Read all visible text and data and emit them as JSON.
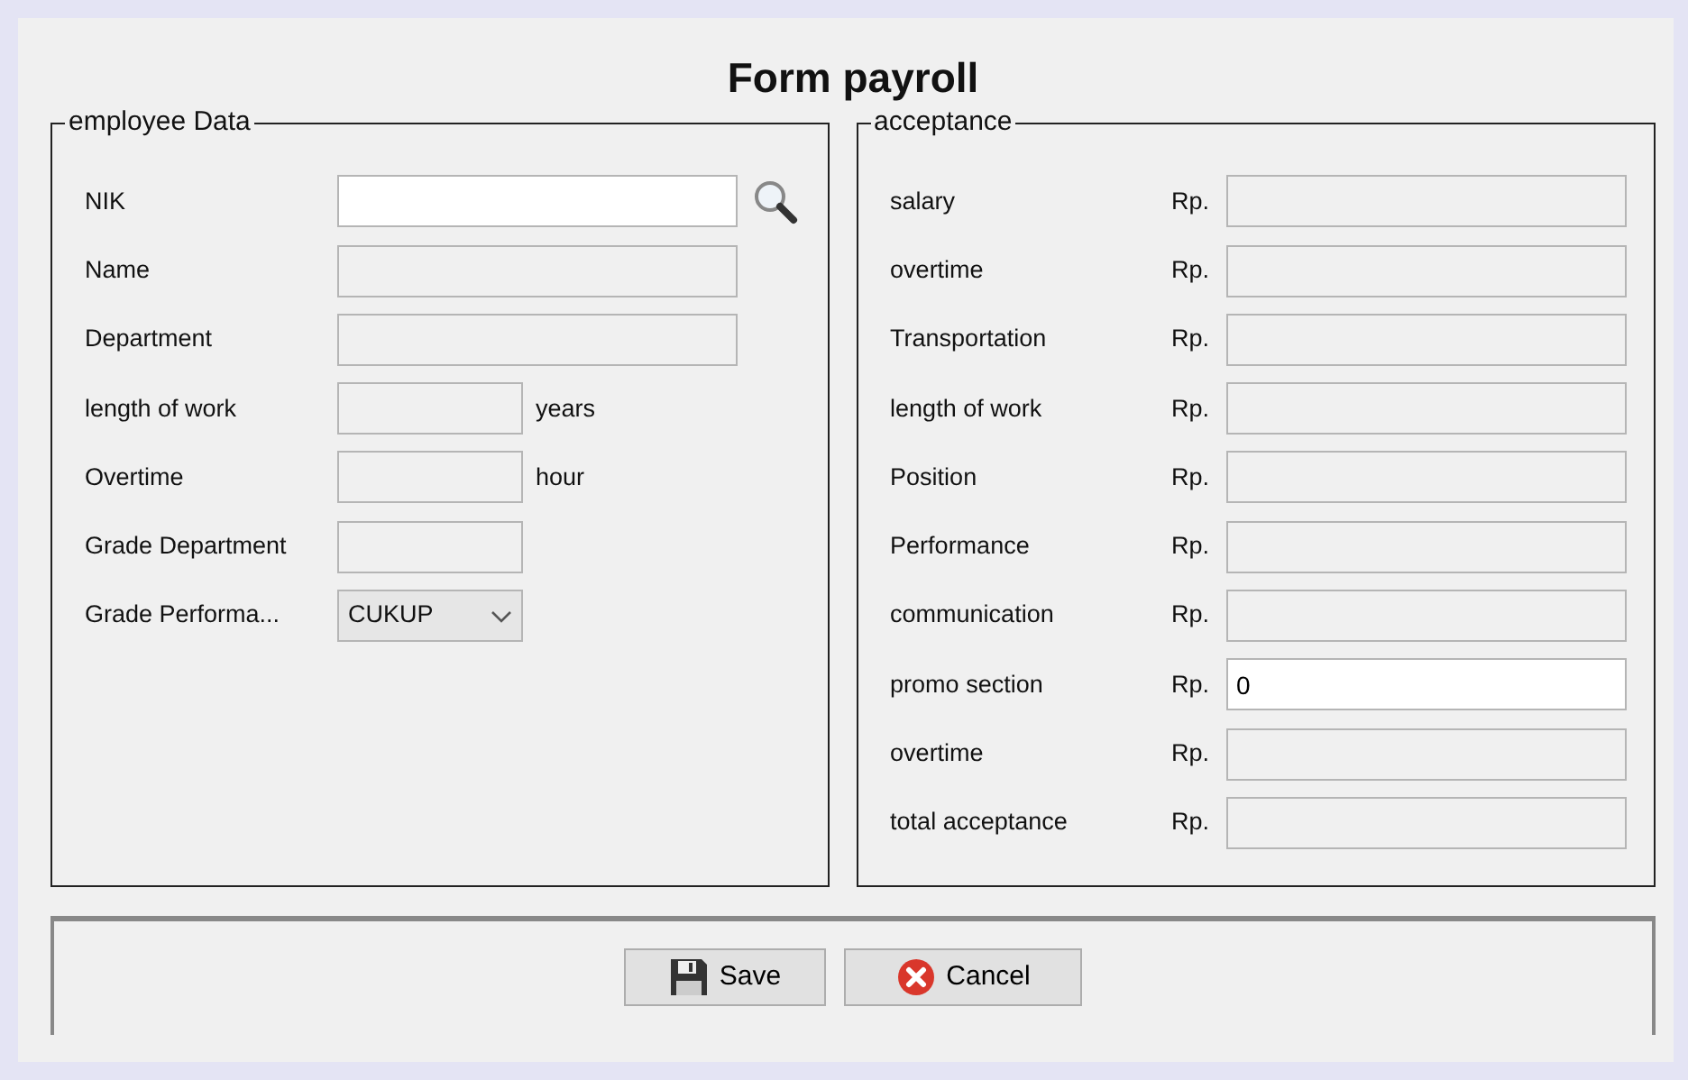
{
  "window": {
    "title": "Form payroll"
  },
  "employee_data": {
    "legend": "employee Data",
    "rows": [
      {
        "label": "NIK",
        "kind": "wide",
        "editable": true,
        "value": "",
        "search": true
      },
      {
        "label": "Name",
        "kind": "wide",
        "editable": false,
        "value": ""
      },
      {
        "label": "Department",
        "kind": "wide",
        "editable": false,
        "value": ""
      },
      {
        "label": "length of work",
        "kind": "short",
        "editable": false,
        "value": "",
        "unit": "years"
      },
      {
        "label": "Overtime",
        "kind": "short",
        "editable": false,
        "value": "",
        "unit": "hour"
      },
      {
        "label": "Grade Department",
        "kind": "short",
        "editable": false,
        "value": ""
      },
      {
        "label": "Grade Performa...",
        "kind": "select",
        "editable": false,
        "value": "CUKUP"
      }
    ]
  },
  "acceptance": {
    "legend": "acceptance",
    "rows": [
      {
        "label": "salary",
        "currency": "Rp.",
        "editable": false,
        "value": ""
      },
      {
        "label": "overtime",
        "currency": "Rp.",
        "editable": false,
        "value": ""
      },
      {
        "label": "Transportation",
        "currency": "Rp.",
        "editable": false,
        "value": ""
      },
      {
        "label": "length of work",
        "currency": "Rp.",
        "editable": false,
        "value": ""
      },
      {
        "label": "Position",
        "currency": "Rp.",
        "editable": false,
        "value": ""
      },
      {
        "label": "Performance",
        "currency": "Rp.",
        "editable": false,
        "value": ""
      },
      {
        "label": "communication",
        "currency": "Rp.",
        "editable": false,
        "value": ""
      },
      {
        "label": "promo section",
        "currency": "Rp.",
        "editable": true,
        "value": "0"
      },
      {
        "label": "overtime",
        "currency": "Rp.",
        "editable": false,
        "value": ""
      },
      {
        "label": "total acceptance",
        "currency": "Rp.",
        "editable": false,
        "value": ""
      }
    ]
  },
  "buttons": [
    {
      "label": "Save",
      "kind": "save"
    },
    {
      "label": "Cancel",
      "kind": "cancel"
    }
  ]
}
